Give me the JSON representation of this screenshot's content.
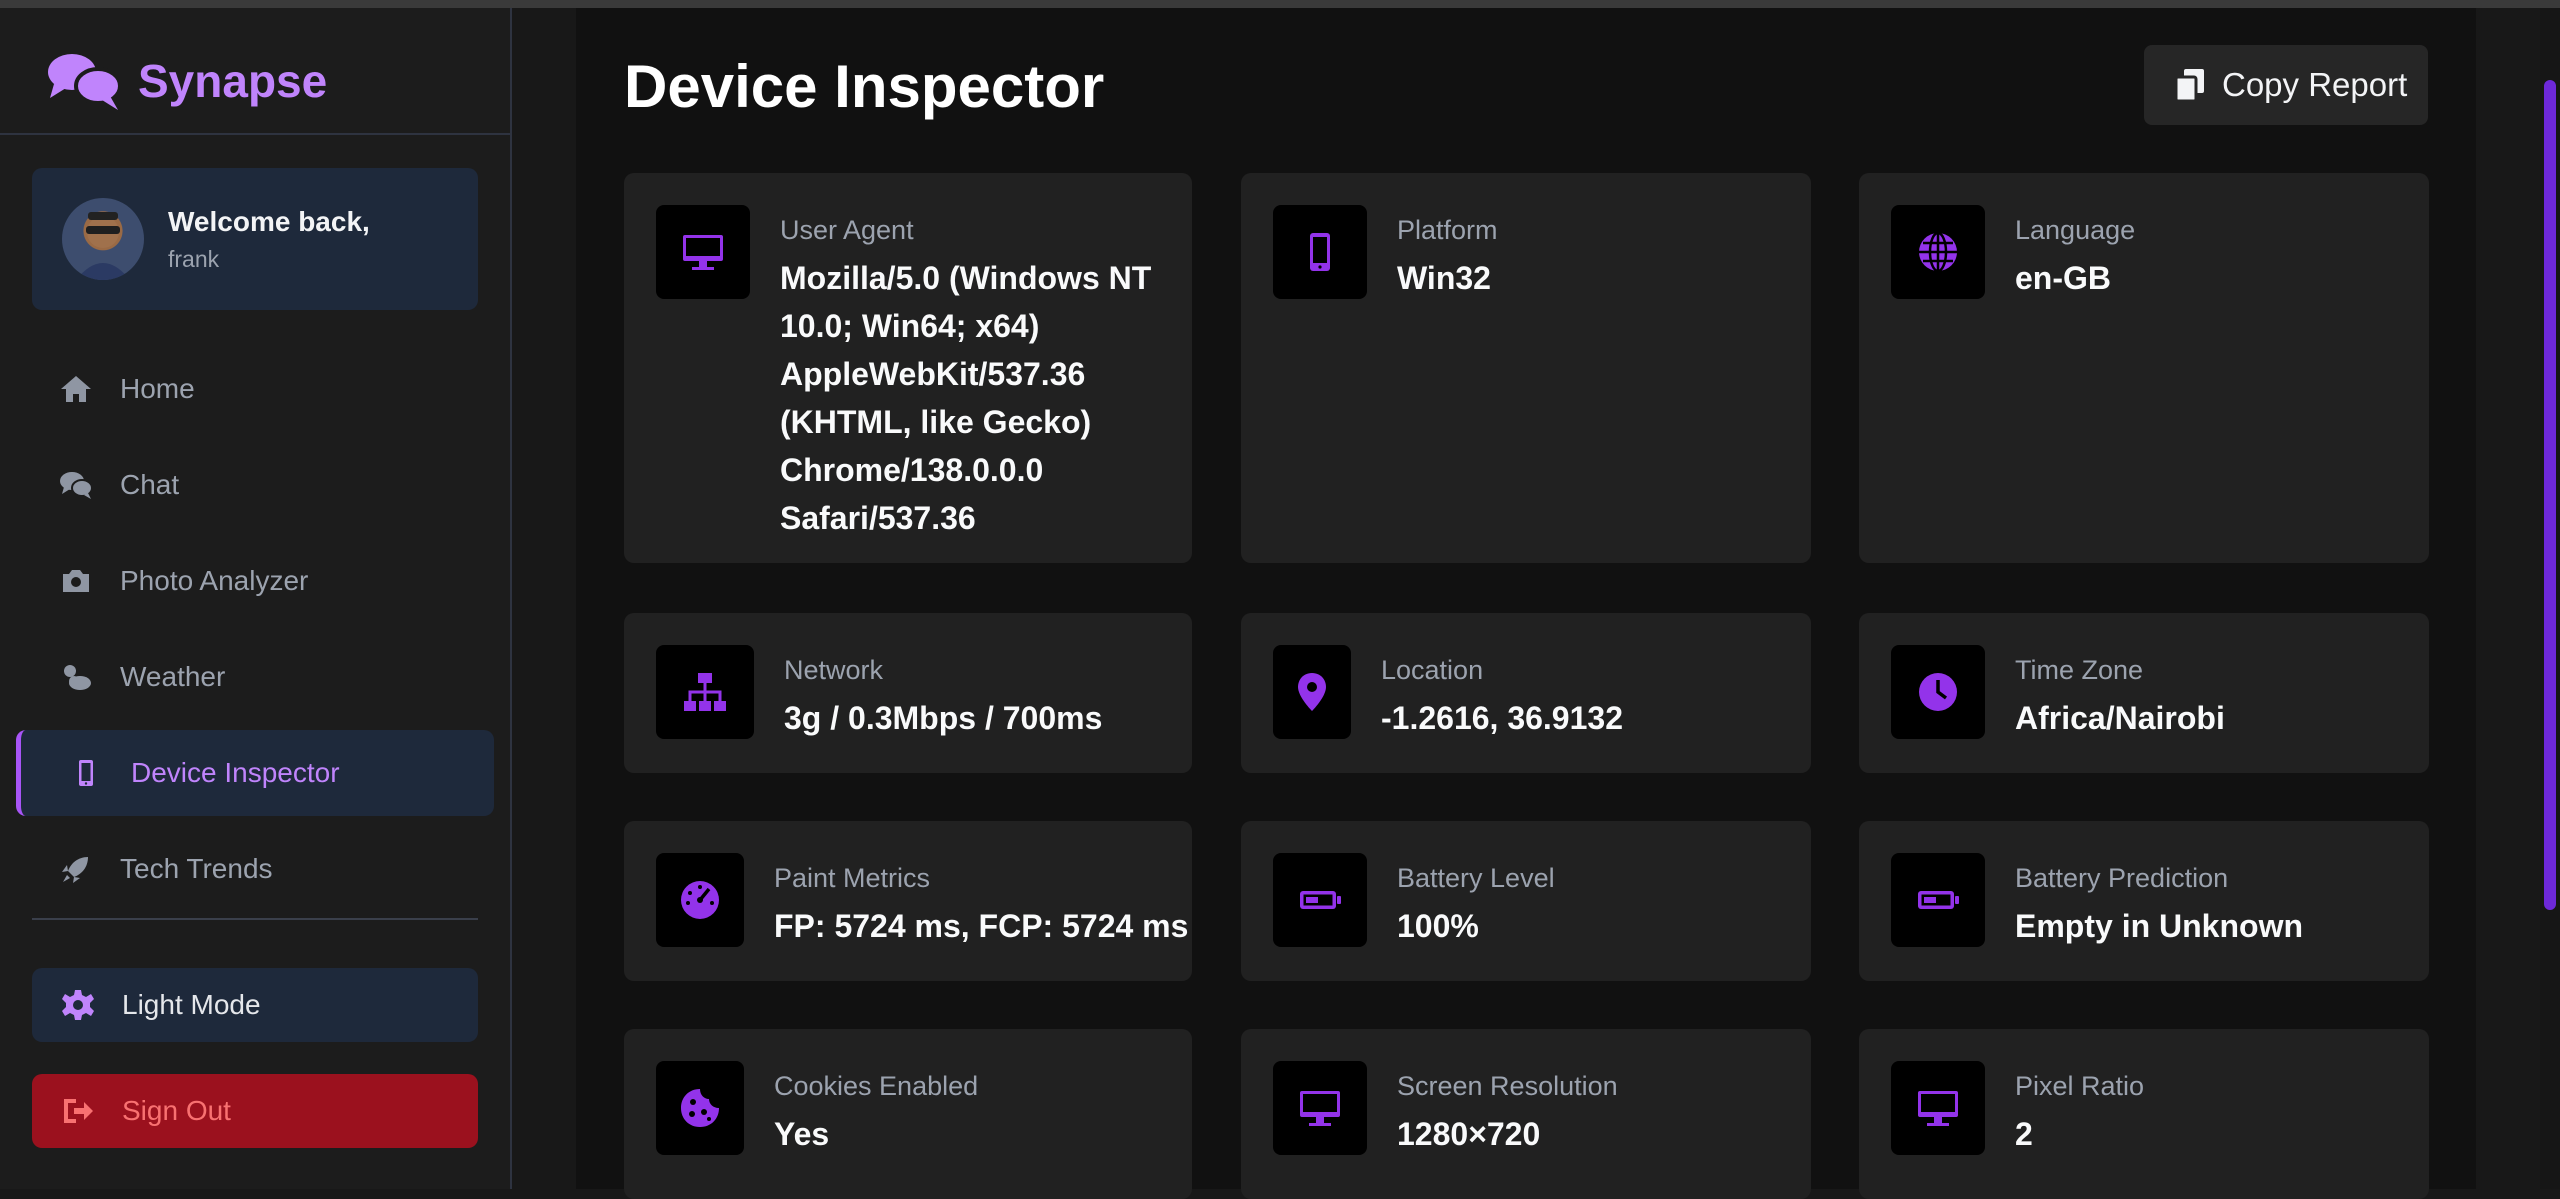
{
  "app": {
    "name": "Synapse"
  },
  "user": {
    "welcome": "Welcome back,",
    "name": "frank"
  },
  "nav": [
    {
      "label": "Home",
      "icon": "home-icon"
    },
    {
      "label": "Chat",
      "icon": "chat-icon"
    },
    {
      "label": "Photo Analyzer",
      "icon": "camera-icon"
    },
    {
      "label": "Weather",
      "icon": "weather-icon"
    },
    {
      "label": "Device Inspector",
      "icon": "mobile-icon",
      "active": true
    },
    {
      "label": "Tech Trends",
      "icon": "rocket-icon"
    }
  ],
  "actions": {
    "light_mode": "Light Mode",
    "sign_out": "Sign Out"
  },
  "page": {
    "title": "Device Inspector",
    "copy_label": "Copy Report"
  },
  "cards": [
    {
      "key": "User Agent",
      "value": "Mozilla/5.0 (Windows NT 10.0; Win64; x64) AppleWebKit/537.36 (KHTML, like Gecko) Chrome/138.0.0.0 Safari/537.36",
      "icon": "desktop-icon"
    },
    {
      "key": "Platform",
      "value": "Win32",
      "icon": "mobile-icon"
    },
    {
      "key": "Language",
      "value": "en-GB",
      "icon": "globe-icon"
    },
    {
      "key": "Network",
      "value": "3g / 0.3Mbps / 700ms",
      "icon": "network-icon"
    },
    {
      "key": "Location",
      "value": "-1.2616, 36.9132",
      "icon": "location-pin-icon"
    },
    {
      "key": "Time Zone",
      "value": "Africa/Nairobi",
      "icon": "clock-icon"
    },
    {
      "key": "Paint Metrics",
      "value": "FP: 5724 ms, FCP: 5724 ms",
      "icon": "gauge-icon"
    },
    {
      "key": "Battery Level",
      "value": "100%",
      "icon": "battery-icon"
    },
    {
      "key": "Battery Prediction",
      "value": "Empty in Unknown",
      "icon": "battery-icon"
    },
    {
      "key": "Cookies Enabled",
      "value": "Yes",
      "icon": "cookie-icon"
    },
    {
      "key": "Screen Resolution",
      "value": "1280×720",
      "icon": "desktop-icon"
    },
    {
      "key": "Pixel Ratio",
      "value": "2",
      "icon": "desktop-icon"
    }
  ],
  "colors": {
    "accent": "#a855f7",
    "icon": "#9333ea",
    "danger": "#9b111e",
    "panel": "#1e293b"
  }
}
